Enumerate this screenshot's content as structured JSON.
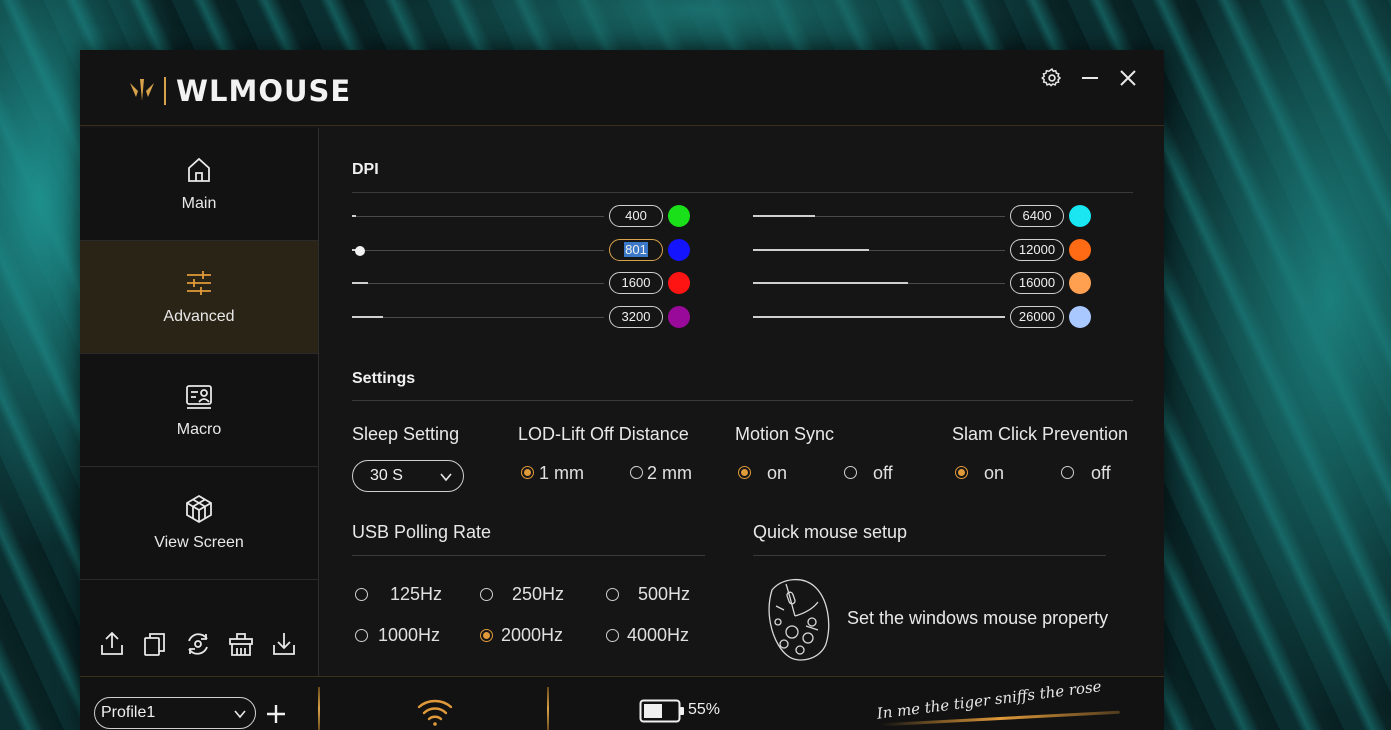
{
  "app": {
    "brand": "WLMOUSE"
  },
  "nav": {
    "items": [
      {
        "label": "Main",
        "icon": "home-icon"
      },
      {
        "label": "Advanced",
        "icon": "sliders-icon",
        "active": true
      },
      {
        "label": "Macro",
        "icon": "macro-icon"
      },
      {
        "label": "View Screen",
        "icon": "cube-icon"
      }
    ]
  },
  "dpi": {
    "title": "DPI",
    "max_value": 26000,
    "stages": [
      {
        "value": "400",
        "level": 400,
        "color": "#19e019"
      },
      {
        "value": "801",
        "level": 801,
        "color": "#1414ff",
        "selected": true
      },
      {
        "value": "1600",
        "level": 1600,
        "color": "#ff1414"
      },
      {
        "value": "3200",
        "level": 3200,
        "color": "#9a0a9a"
      },
      {
        "value": "6400",
        "level": 6400,
        "color": "#19e6f0"
      },
      {
        "value": "12000",
        "level": 12000,
        "color": "#ff6a14"
      },
      {
        "value": "16000",
        "level": 16000,
        "color": "#ffa050"
      },
      {
        "value": "26000",
        "level": 26000,
        "color": "#a8c8ff"
      }
    ]
  },
  "settings": {
    "title": "Settings",
    "sleep": {
      "label": "Sleep Setting",
      "value": "30 S"
    },
    "lod": {
      "label": "LOD-Lift Off Distance",
      "options": [
        "1 mm",
        "2 mm"
      ],
      "selected": 0
    },
    "motion_sync": {
      "label": "Motion Sync",
      "options": [
        "on",
        "off"
      ],
      "selected": 0
    },
    "slam_click": {
      "label": "Slam Click Prevention",
      "options": [
        "on",
        "off"
      ],
      "selected": 0
    },
    "polling": {
      "label": "USB Polling Rate",
      "options": [
        "125Hz",
        "250Hz",
        "500Hz",
        "1000Hz",
        "2000Hz",
        "4000Hz"
      ],
      "selected": 4
    },
    "quick_setup": {
      "label": "Quick mouse setup",
      "text": "Set the windows mouse property"
    }
  },
  "status": {
    "profile": "Profile1",
    "battery": "55%",
    "battery_level": 0.55,
    "slogan": "In me the tiger sniffs the rose"
  },
  "colors": {
    "accent": "#e09a3a",
    "panel": "#151515"
  }
}
